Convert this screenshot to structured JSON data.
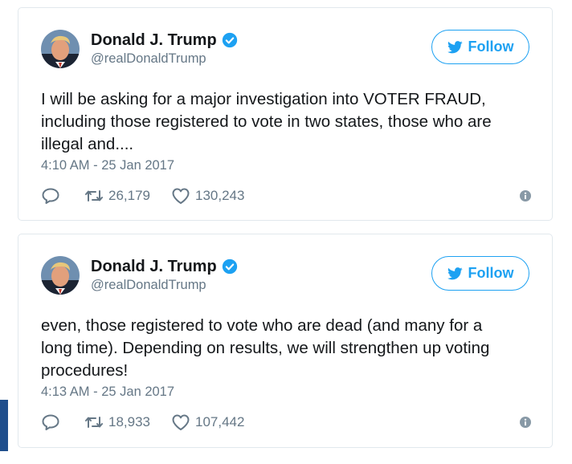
{
  "colors": {
    "accent": "#1da1f2",
    "text_primary": "#14171a",
    "text_secondary": "#657786",
    "border": "#e1e8ed",
    "side_strip": "#1f4e8c"
  },
  "tweets": [
    {
      "author": {
        "display_name": "Donald J. Trump",
        "handle": "@realDonaldTrump",
        "verified": true
      },
      "follow_label": "Follow",
      "text_lines": [
        "I will be asking for a major investigation into VOTER FRAUD,",
        "including those registered to vote in two states, those who are",
        "illegal and...."
      ],
      "timestamp": "4:10 AM - 25 Jan 2017",
      "retweets": "26,179",
      "likes": "130,243"
    },
    {
      "author": {
        "display_name": "Donald J. Trump",
        "handle": "@realDonaldTrump",
        "verified": true
      },
      "follow_label": "Follow",
      "text_lines": [
        "even, those registered to vote who are dead (and many for a",
        "long time). Depending on results, we will strengthen up voting",
        "procedures!"
      ],
      "timestamp": "4:13 AM - 25 Jan 2017",
      "retweets": "18,933",
      "likes": "107,442"
    }
  ],
  "icons": {
    "verified": "verified-badge-icon",
    "follow": "twitter-bird-icon",
    "reply": "reply-icon",
    "retweet": "retweet-icon",
    "like": "heart-icon",
    "info": "info-icon"
  }
}
